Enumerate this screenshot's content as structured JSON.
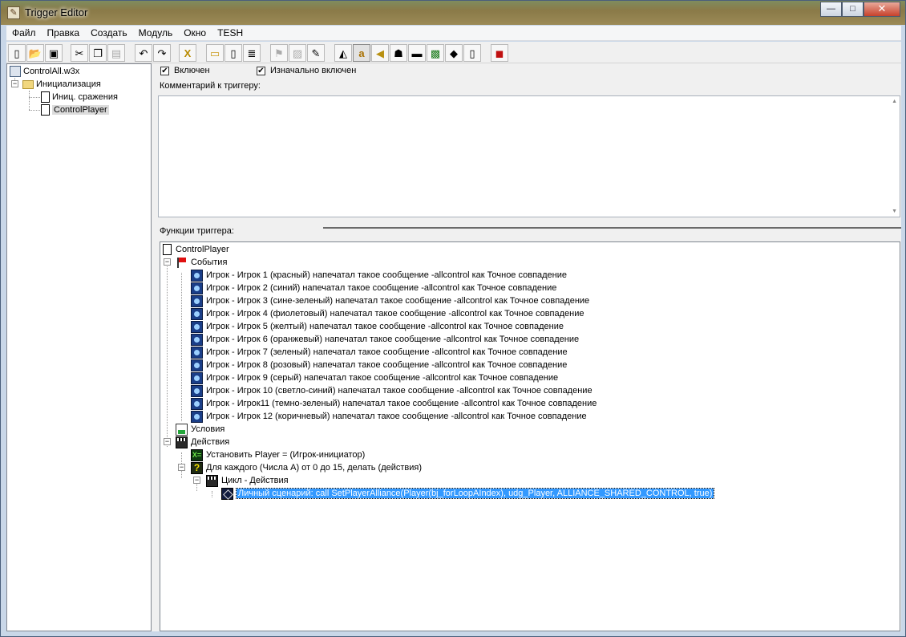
{
  "window": {
    "title": "Trigger Editor",
    "controls": {
      "minimize": "—",
      "maximize": "□",
      "close": "✕"
    }
  },
  "menu": [
    "Файл",
    "Правка",
    "Создать",
    "Модуль",
    "Окно",
    "TESH"
  ],
  "toolbar_icons": [
    "new-file-icon",
    "open-folder-icon",
    "save-icon",
    "cut-icon",
    "copy-icon",
    "paste-icon",
    "undo-icon",
    "redo-icon",
    "close-x-icon",
    "new-category-icon",
    "new-trigger-icon",
    "new-comment-icon",
    "new-event-icon",
    "new-condition-icon",
    "new-action-icon",
    "terrain-editor-icon",
    "trigger-editor-icon",
    "sound-editor-icon",
    "object-editor-icon",
    "campaign-editor-icon",
    "ai-editor-icon",
    "import-manager-icon",
    "object-manager-icon",
    "test-map-icon"
  ],
  "left_tree": {
    "map": "ControlAll.w3x",
    "category": "Инициализация",
    "triggers": [
      "Иниц. сражения",
      "ControlPlayer"
    ],
    "selected": "ControlPlayer"
  },
  "options": {
    "enabled_label": "Включен",
    "enabled_checked": "✔",
    "initially_on_label": "Изначально включен",
    "initially_on_checked": "✔"
  },
  "comment": {
    "label": "Комментарий к триггеру:",
    "text": ""
  },
  "functions": {
    "label": "Функции триггера:",
    "trigger_name": "ControlPlayer",
    "events_label": "События",
    "events": [
      "Игрок - Игрок 1 (красный) напечатал такое сообщение -allcontrol как Точное совпадение",
      "Игрок - Игрок 2 (синий) напечатал такое сообщение -allcontrol как Точное совпадение",
      "Игрок - Игрок 3 (сине-зеленый) напечатал такое сообщение -allcontrol как Точное совпадение",
      "Игрок - Игрок 4 (фиолетовый) напечатал такое сообщение -allcontrol как Точное совпадение",
      "Игрок - Игрок 5 (желтый) напечатал такое сообщение -allcontrol как Точное совпадение",
      "Игрок - Игрок 6 (оранжевый) напечатал такое сообщение -allcontrol как Точное совпадение",
      "Игрок - Игрок 7 (зеленый) напечатал такое сообщение -allcontrol как Точное совпадение",
      "Игрок - Игрок 8 (розовый) напечатал такое сообщение -allcontrol как Точное совпадение",
      "Игрок - Игрок 9 (серый) напечатал такое сообщение -allcontrol как Точное совпадение",
      "Игрок - Игрок 10 (светло-синий) напечатал такое сообщение -allcontrol как Точное совпадение",
      "Игрок - Игрок11 (темно-зеленый) напечатал такое сообщение -allcontrol как Точное совпадение",
      "Игрок - Игрок 12 (коричневый) напечатал такое сообщение -allcontrol как Точное совпадение"
    ],
    "conditions_label": "Условия",
    "actions_label": "Действия",
    "actions": {
      "set_player": "Установить Player = (Игрок-инициатор)",
      "for_each": "Для каждого (Числа A) от 0 до 15, делать (действия)",
      "loop_label": "Цикл - Действия",
      "custom_script": "Личный сценарий: call SetPlayerAlliance(Player(bj_forLoopAIndex), udg_Player, ALLIANCE_SHARED_CONTROL, true)"
    }
  }
}
